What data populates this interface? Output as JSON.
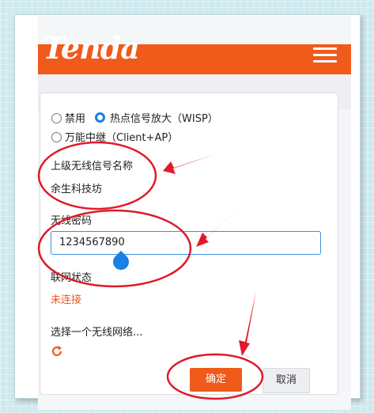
{
  "header": {
    "logo_text": "Tenda",
    "menu_icon": "hamburger-menu-icon",
    "brand_color": "#f05a1b"
  },
  "mode": {
    "options": [
      {
        "label": "禁用",
        "selected": false
      },
      {
        "label": "热点信号放大（WISP）",
        "selected": true
      },
      {
        "label": "万能中继（Client+AP）",
        "selected": false
      }
    ]
  },
  "upstream": {
    "label": "上级无线信号名称",
    "value": "余生科技坊"
  },
  "password": {
    "label": "无线密码",
    "value": "1234567890"
  },
  "status": {
    "label": "联网状态",
    "value": "未连接",
    "value_color": "#f05a1b"
  },
  "network": {
    "choose_label": "选择一个无线网络..."
  },
  "actions": {
    "confirm": "确定",
    "cancel": "取消"
  }
}
